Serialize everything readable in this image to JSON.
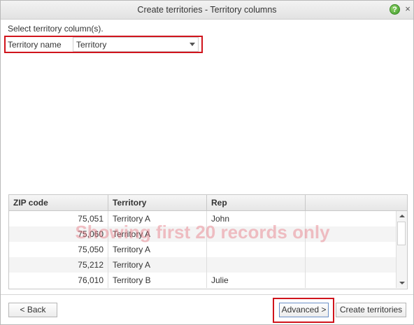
{
  "window": {
    "title": "Create territories - Territory columns",
    "help_icon_glyph": "?",
    "close_icon_glyph": "×"
  },
  "prompt": "Select territory column(s).",
  "territory_column": {
    "label": "Territory name",
    "selected": "Territory"
  },
  "grid": {
    "columns": [
      "ZIP code",
      "Territory",
      "Rep",
      ""
    ],
    "rows": [
      {
        "zip": "75,051",
        "territory": "Territory A",
        "rep": "John"
      },
      {
        "zip": "75,060",
        "territory": "Territory A",
        "rep": ""
      },
      {
        "zip": "75,050",
        "territory": "Territory A",
        "rep": ""
      },
      {
        "zip": "75,212",
        "territory": "Territory A",
        "rep": ""
      },
      {
        "zip": "76,010",
        "territory": "Territory B",
        "rep": "Julie"
      }
    ],
    "watermark": "Showing first 20 records only"
  },
  "footer": {
    "back_label": "< Back",
    "advanced_label": "Advanced >",
    "create_label": "Create territories"
  },
  "colors": {
    "highlight": "#d0141c",
    "help_green": "#3f9a2a"
  }
}
